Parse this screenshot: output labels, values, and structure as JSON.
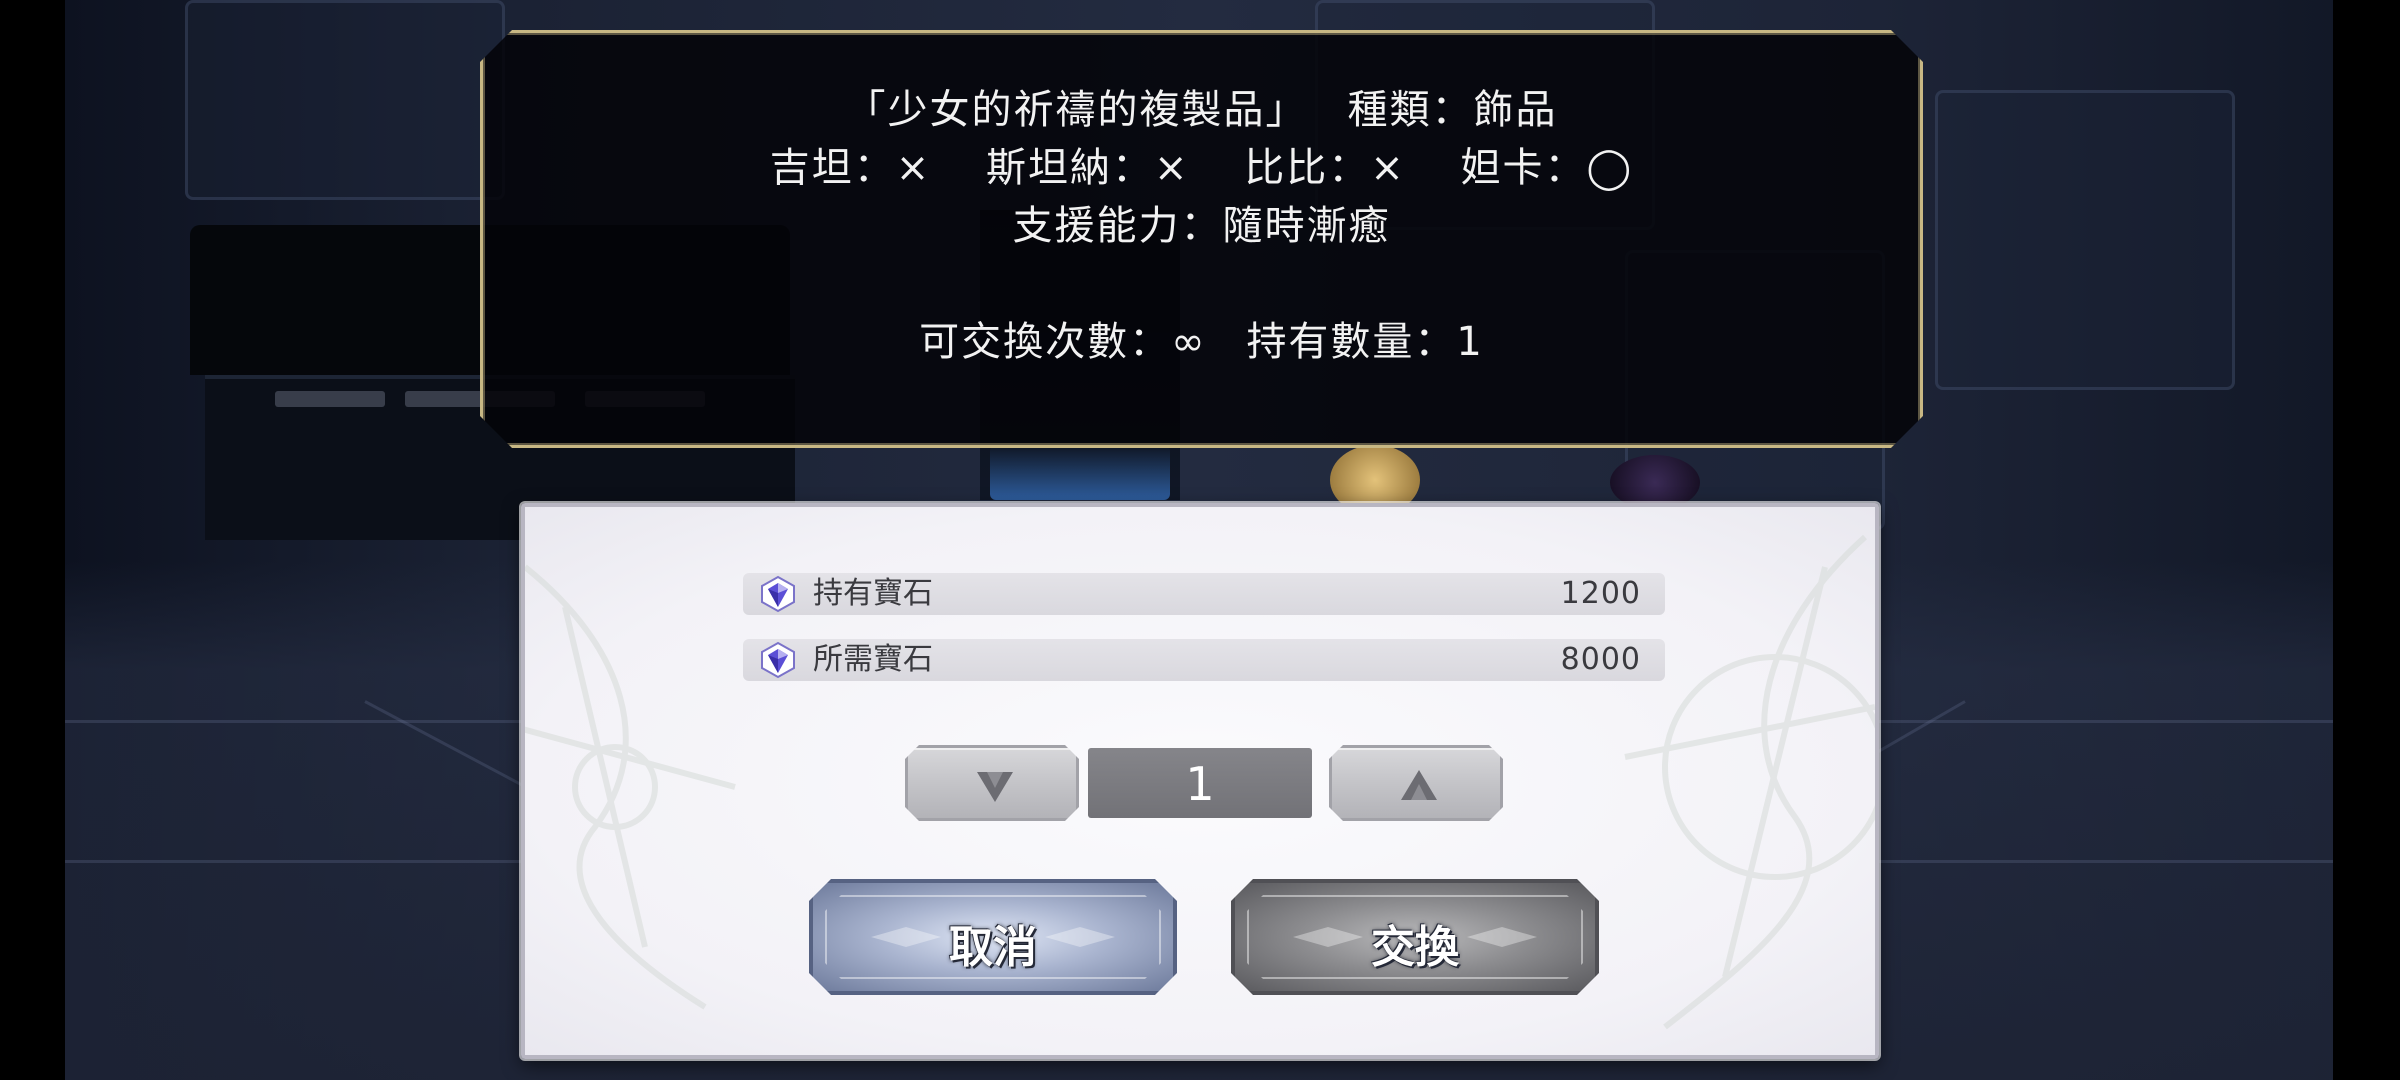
{
  "info_panel": {
    "item_name": "「少女的祈禱的複製品」",
    "type_text": "種類：飾品",
    "compat": [
      {
        "name": "吉坦",
        "mark": "×"
      },
      {
        "name": "斯坦納",
        "mark": "×"
      },
      {
        "name": "比比",
        "mark": "×"
      },
      {
        "name": "妲卡",
        "mark": "◯"
      }
    ],
    "support_text": "支援能力：隨時漸癒",
    "exchange_count_text": "可交換次數：∞",
    "owned_text": "持有數量：1"
  },
  "dialog": {
    "owned_gems": {
      "label": "持有寶石",
      "value": "1200",
      "icon": "gem-icon"
    },
    "required_gems": {
      "label": "所需寶石",
      "value": "8000",
      "icon": "gem-icon"
    },
    "quantity": "1",
    "decrease_icon": "triangle-down-icon",
    "increase_icon": "triangle-up-icon",
    "cancel_label": "取消",
    "exchange_label": "交換"
  },
  "colors": {
    "panel_border": "#c8b884",
    "cancel_button": "#a9b4cf",
    "exchange_button": "#8c8c8f",
    "quantity_box": "#7c7c81",
    "gem_accent": "#5b4fd6"
  }
}
